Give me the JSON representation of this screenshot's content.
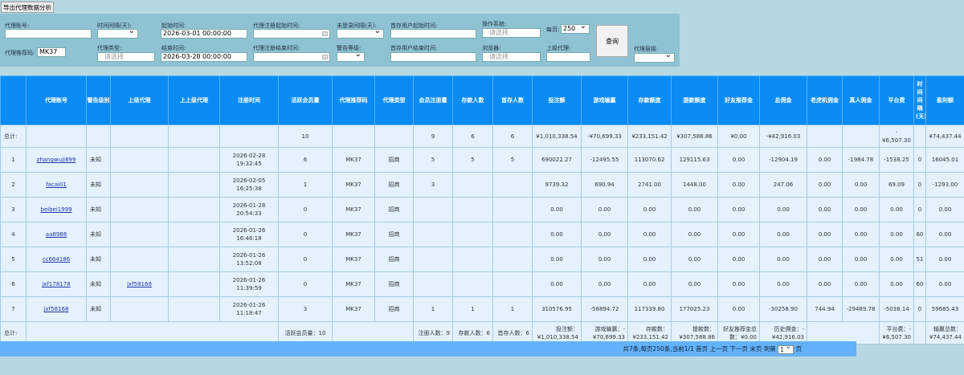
{
  "toolbar": {
    "export_label": "导出代理数据分析",
    "query_label": "查询"
  },
  "filters": {
    "agent_account": {
      "label": "代理账号:",
      "value": ""
    },
    "referral_code": {
      "label": "代理推荐码:",
      "value": "MK37"
    },
    "time_interval": {
      "label": "时间间隔(天):",
      "value": ""
    },
    "agent_type": {
      "label": "代理类型:",
      "placeholder": "请选择"
    },
    "start_time": {
      "label": "起始时间:",
      "value": "2026-03-01 00:00:00"
    },
    "end_time": {
      "label": "结束时间:",
      "value": "2026-03-28 00:00:00"
    },
    "reg_start": {
      "label": "代理注册起始时间:",
      "value": ""
    },
    "reg_end": {
      "label": "代理注册结束时间:",
      "value": ""
    },
    "login_interval": {
      "label": "未登录间隔(天):",
      "value": ""
    },
    "warning_level": {
      "label": "警告等级:",
      "value": ""
    },
    "first_dep_start": {
      "label": "首存用户起始时间:",
      "value": ""
    },
    "first_dep_end": {
      "label": "首存用户结束时间:",
      "value": ""
    },
    "os": {
      "label": "操作系统:",
      "placeholder": "请选择"
    },
    "browser": {
      "label": "浏览器:",
      "placeholder": "请选择"
    },
    "per_page": {
      "label": "每页:",
      "value": "250"
    },
    "parent_agent": {
      "label": "上级代理:",
      "value": ""
    },
    "agent_level": {
      "label": "代理层级:",
      "value": ""
    }
  },
  "table": {
    "headers": [
      "",
      "代理账号",
      "警告级别",
      "上级代理",
      "上上级代理",
      "注册时间",
      "活跃会员量",
      "代理推荐码",
      "代理类型",
      "会员注册量",
      "存款人数",
      "首存人数",
      "投注额",
      "游戏输赢",
      "存款额度",
      "提款额度",
      "好友推荐金",
      "总佣金",
      "老虎机佣金",
      "真人佣金",
      "平台费",
      "时间间隔(天)",
      "盈利额"
    ],
    "top_total": [
      "总计:",
      "",
      "",
      "",
      "",
      "",
      "10",
      "",
      "",
      "9",
      "6",
      "6",
      "¥1,010,338.54",
      "-¥70,699.33",
      "¥233,151.42",
      "¥307,588.86",
      "¥0.00",
      "-¥42,916.03",
      "",
      "",
      "-\n¥6,507.30",
      "",
      "¥74,437.44"
    ],
    "rows": [
      [
        "1",
        "zhangwuji899",
        "未知",
        "",
        "",
        "2026-02-28\n19:32:45",
        "6",
        "MK37",
        "招商",
        "5",
        "5",
        "5",
        "690022.27",
        "-12495.55",
        "113070.62",
        "129115.63",
        "0.00",
        "-12904.19",
        "0.00",
        "-1984.78",
        "-1538.25",
        "0",
        "16045.01"
      ],
      [
        "2",
        "facai01",
        "未知",
        "",
        "",
        "2026-02-05\n16:25:38",
        "1",
        "MK37",
        "招商",
        "3",
        "",
        "",
        "9739.32",
        "690.94",
        "2741.00",
        "1448.00",
        "0.00",
        "247.06",
        "0.00",
        "0.00",
        "69.09",
        "0",
        "-1293.00"
      ],
      [
        "3",
        "beibei1999",
        "未知",
        "",
        "",
        "2026-01-28\n20:54:33",
        "0",
        "MK37",
        "招商",
        "",
        "",
        "",
        "0.00",
        "0.00",
        "0.00",
        "0.00",
        "0.00",
        "0.00",
        "0.00",
        "0.00",
        "0.00",
        "0",
        "0.00"
      ],
      [
        "4",
        "aa8988",
        "未知",
        "",
        "",
        "2026-01-26\n16:46:18",
        "0",
        "MK37",
        "招商",
        "",
        "",
        "",
        "0.00",
        "0.00",
        "0.00",
        "0.00",
        "0.00",
        "0.00",
        "0.00",
        "0.00",
        "0.00",
        "60",
        "0.00"
      ],
      [
        "5",
        "cc664186",
        "未知",
        "",
        "",
        "2026-01-26\n13:52:08",
        "0",
        "MK37",
        "招商",
        "",
        "",
        "",
        "0.00",
        "0.00",
        "0.00",
        "0.00",
        "0.00",
        "0.00",
        "0.00",
        "0.00",
        "0.00",
        "51",
        "0.00"
      ],
      [
        "6",
        "jxf178178",
        "未知",
        "jxf58168",
        "",
        "2026-01-26\n11:39:59",
        "0",
        "MK37",
        "招商",
        "",
        "",
        "",
        "0.00",
        "0.00",
        "0.00",
        "0.00",
        "0.00",
        "0.00",
        "0.00",
        "0.00",
        "0.00",
        "60",
        "0.00"
      ],
      [
        "7",
        "jxf58168",
        "未知",
        "",
        "",
        "2026-01-26\n11:18:47",
        "3",
        "MK37",
        "招商",
        "1",
        "1",
        "1",
        "310576.95",
        "-58894.72",
        "117339.80",
        "177025.23",
        "0.00",
        "-30258.90",
        "744.94",
        "-29489.78",
        "-5038.14",
        "0",
        "59685.43"
      ]
    ],
    "bottom_total": {
      "label": "总计:",
      "active": "活跃会员量：10",
      "reg": "注册人数：9",
      "deposit": "存款人数：6",
      "first": "首存人数：6",
      "bet": "投注额：¥1,010,338.54",
      "game": "游戏输赢：-¥70,699.33",
      "dep_amt": "存款数：¥233,151.42",
      "wd_amt": "提款数：¥307,588.86",
      "friend": "好友推荐金总数：¥0.00",
      "hist_comm": "历史佣金：-¥42,916.03",
      "platform": "平台费：-¥6,507.30",
      "profit": "输赢总数：¥74,437.44"
    }
  },
  "pager": {
    "summary": "共7条,每页250条,当前1/1 首页 上一页 下一页 末页 到第",
    "page": "1",
    "suffix": "页"
  },
  "colors": {
    "header": "#0a8cf5",
    "row": "#e3f2fd",
    "pager": "#63b2fb",
    "filter": "#8fc3d3",
    "background": "#b6d8e2"
  }
}
